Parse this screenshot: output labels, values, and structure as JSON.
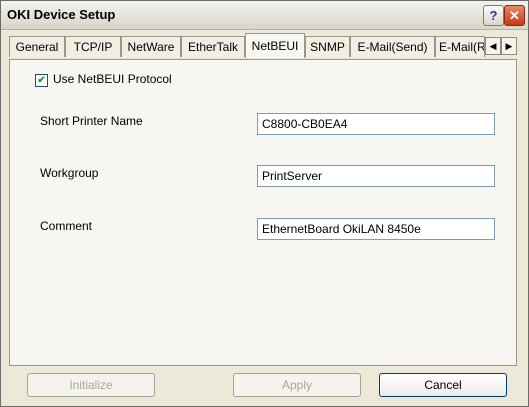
{
  "window": {
    "title": "OKI Device Setup",
    "help_label": "?",
    "close_label": "✕"
  },
  "tabs": [
    {
      "label": "General"
    },
    {
      "label": "TCP/IP"
    },
    {
      "label": "NetWare"
    },
    {
      "label": "EtherTalk"
    },
    {
      "label": "NetBEUI",
      "active": true
    },
    {
      "label": "SNMP"
    },
    {
      "label": "E-Mail(Send)"
    },
    {
      "label": "E-Mail(R"
    }
  ],
  "tab_scroll": {
    "left": "◀",
    "right": "▶"
  },
  "netbeui": {
    "use_protocol": {
      "label": "Use NetBEUI Protocol",
      "checked": true,
      "mark": "✔"
    },
    "short_printer_name": {
      "label": "Short Printer Name",
      "value": "C8800-CB0EA4"
    },
    "workgroup": {
      "label": "Workgroup",
      "value": "PrintServer"
    },
    "comment": {
      "label": "Comment",
      "value": "EthernetBoard OkiLAN 8450e"
    }
  },
  "buttons": {
    "initialize": "Initialize",
    "apply": "Apply",
    "cancel": "Cancel"
  }
}
